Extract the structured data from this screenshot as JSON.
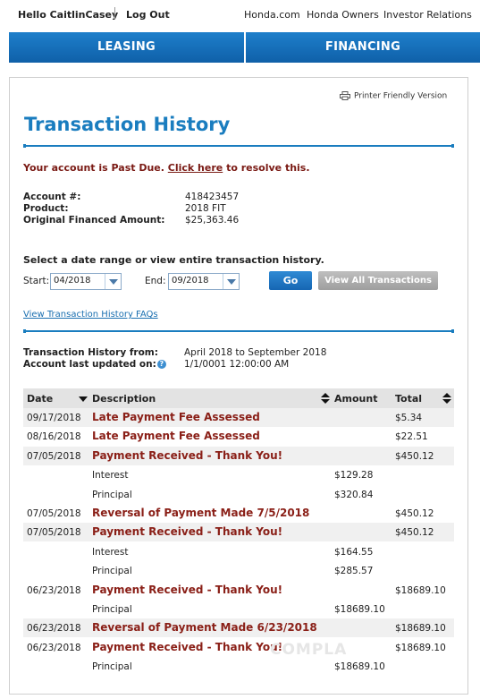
{
  "topbar": {
    "greeting": "Hello CaitlinCasey",
    "logout": "Log Out",
    "links": [
      "Honda.com",
      "Honda Owners",
      "Investor Relations"
    ]
  },
  "nav": {
    "tabs": [
      "LEASING",
      "FINANCING"
    ]
  },
  "printer_link": "Printer Friendly Version",
  "page_title": "Transaction History",
  "alert": {
    "prefix": "Your account is Past Due. ",
    "link": "Click here",
    "suffix": " to resolve this."
  },
  "account": {
    "number_label": "Account #:",
    "number": "418423457",
    "product_label": "Product:",
    "product": "2018 FIT",
    "financed_label": "Original Financed Amount:",
    "financed": "$25,363.46"
  },
  "date_filter": {
    "prompt": "Select a date range or view entire transaction history.",
    "start_label": "Start:",
    "start_value": "04/2018",
    "end_label": "End:",
    "end_value": "09/2018",
    "go_label": "Go",
    "view_all_label": "View All Transactions"
  },
  "faq_link": "View Transaction History FAQs",
  "history_info": {
    "from_label": "Transaction History from:",
    "from_value": "April 2018 to September 2018",
    "updated_label": "Account last updated on:",
    "help_glyph": "?",
    "updated_value": "1/1/0001 12:00:00 AM"
  },
  "table": {
    "columns": {
      "date": "Date",
      "description": "Description",
      "amount": "Amount",
      "total": "Total"
    },
    "rows": [
      {
        "date": "09/17/2018",
        "description": "Late Payment Fee Assessed",
        "amount": "",
        "total": "$5.34"
      },
      {
        "date": "08/16/2018",
        "description": "Late Payment Fee Assessed",
        "amount": "",
        "total": "$22.51"
      },
      {
        "date": "07/05/2018",
        "description": "Payment Received - Thank You!",
        "amount": "",
        "total": "$450.12"
      },
      {
        "date": "",
        "description": "Interest",
        "amount": "$129.28",
        "total": ""
      },
      {
        "date": "",
        "description": "Principal",
        "amount": "$320.84",
        "total": ""
      },
      {
        "date": "07/05/2018",
        "description": "Reversal of Payment Made 7/5/2018",
        "amount": "",
        "total": "$450.12"
      },
      {
        "date": "07/05/2018",
        "description": "Payment Received - Thank You!",
        "amount": "",
        "total": "$450.12"
      },
      {
        "date": "",
        "description": "Interest",
        "amount": "$164.55",
        "total": ""
      },
      {
        "date": "",
        "description": "Principal",
        "amount": "$285.57",
        "total": ""
      },
      {
        "date": "06/23/2018",
        "description": "Payment Received - Thank You!",
        "amount": "",
        "total": "$18689.10"
      },
      {
        "date": "",
        "description": "Principal",
        "amount": "$18689.10",
        "total": ""
      },
      {
        "date": "06/23/2018",
        "description": "Reversal of Payment Made 6/23/2018",
        "amount": "",
        "total": "$18689.10"
      },
      {
        "date": "06/23/2018",
        "description": "Payment Received - Thank You!",
        "amount": "",
        "total": "$18689.10"
      },
      {
        "date": "",
        "description": "Principal",
        "amount": "$18689.10",
        "total": ""
      }
    ]
  },
  "watermark": "COMPLA",
  "colors": {
    "brand_blue": "#1a7dbf",
    "nav_blue": "#1666b3",
    "alert_red": "#7a1a14",
    "desc_red": "#8a1f17"
  }
}
